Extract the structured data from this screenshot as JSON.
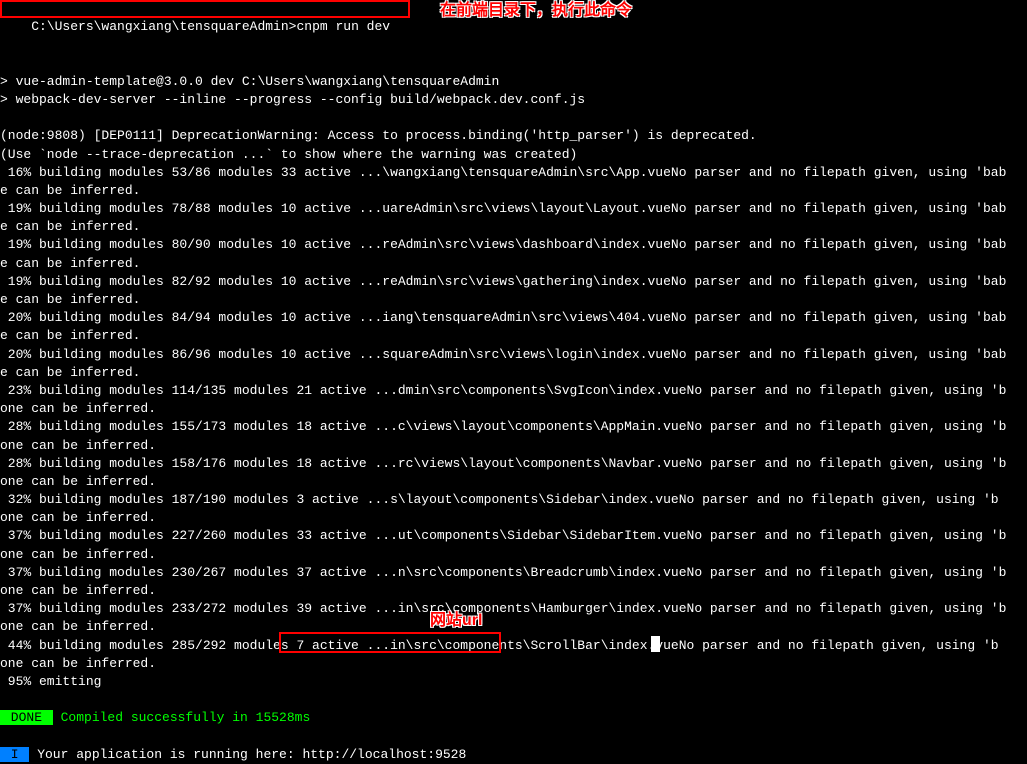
{
  "prompt": {
    "path": "C:\\Users\\wangxiang\\tensquareAdmin>",
    "command": "cnpm run dev"
  },
  "annotations": {
    "top": "在前端目录下，执行此命令",
    "bottom": "网站url"
  },
  "output": {
    "line1": "> vue-admin-template@3.0.0 dev C:\\Users\\wangxiang\\tensquareAdmin",
    "line2": "> webpack-dev-server --inline --progress --config build/webpack.dev.conf.js",
    "dep_warning": "(node:9808) [DEP0111] DeprecationWarning: Access to process.binding('http_parser') is deprecated.",
    "dep_hint": "(Use `node --trace-deprecation ...` to show where the warning was created)",
    "build_lines": [
      " 16% building modules 53/86 modules 33 active ...\\wangxiang\\tensquareAdmin\\src\\App.vueNo parser and no filepath given, using 'bab",
      "e can be inferred.",
      " 19% building modules 78/88 modules 10 active ...uareAdmin\\src\\views\\layout\\Layout.vueNo parser and no filepath given, using 'bab",
      "e can be inferred.",
      " 19% building modules 80/90 modules 10 active ...reAdmin\\src\\views\\dashboard\\index.vueNo parser and no filepath given, using 'bab",
      "e can be inferred.",
      " 19% building modules 82/92 modules 10 active ...reAdmin\\src\\views\\gathering\\index.vueNo parser and no filepath given, using 'bab",
      "e can be inferred.",
      " 20% building modules 84/94 modules 10 active ...iang\\tensquareAdmin\\src\\views\\404.vueNo parser and no filepath given, using 'bab",
      "e can be inferred.",
      " 20% building modules 86/96 modules 10 active ...squareAdmin\\src\\views\\login\\index.vueNo parser and no filepath given, using 'bab",
      "e can be inferred.",
      " 23% building modules 114/135 modules 21 active ...dmin\\src\\components\\SvgIcon\\index.vueNo parser and no filepath given, using 'b",
      "one can be inferred.",
      " 28% building modules 155/173 modules 18 active ...c\\views\\layout\\components\\AppMain.vueNo parser and no filepath given, using 'b",
      "one can be inferred.",
      " 28% building modules 158/176 modules 18 active ...rc\\views\\layout\\components\\Navbar.vueNo parser and no filepath given, using 'b",
      "one can be inferred.",
      " 32% building modules 187/190 modules 3 active ...s\\layout\\components\\Sidebar\\index.vueNo parser and no filepath given, using 'b",
      "one can be inferred.",
      " 37% building modules 227/260 modules 33 active ...ut\\components\\Sidebar\\SidebarItem.vueNo parser and no filepath given, using 'b",
      "one can be inferred.",
      " 37% building modules 230/267 modules 37 active ...n\\src\\components\\Breadcrumb\\index.vueNo parser and no filepath given, using 'b",
      "one can be inferred.",
      " 37% building modules 233/272 modules 39 active ...in\\src\\components\\Hamburger\\index.vueNo parser and no filepath given, using 'b",
      "one can be inferred.",
      " 44% building modules 285/292 modules 7 active ...in\\src\\components\\ScrollBar\\index.vueNo parser and no filepath given, using 'b",
      "one can be inferred.",
      " 95% emitting"
    ],
    "done_label": " DONE ",
    "done_text": " Compiled successfully in 15528ms",
    "info_label": " I ",
    "info_text": " Your application is running here: http://localhost:9528"
  }
}
